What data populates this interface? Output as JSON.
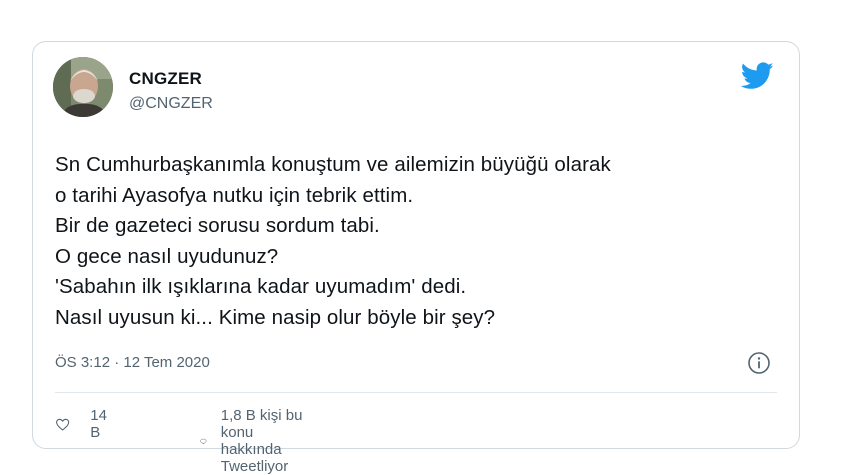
{
  "tweet": {
    "author_name": "CNGZER",
    "author_handle": "@CNGZER",
    "text_lines": [
      "Sn Cumhurbaşkanımla konuştum ve ailemizin büyüğü olarak",
      "o tarihi Ayasofya nutku için tebrik ettim.",
      "Bir de gazeteci sorusu sordum tabi.",
      "O gece nasıl uyudunuz?",
      "'Sabahın ilk ışıklarına kadar uyumadım' dedi.",
      "Nasıl uyusun ki... Kime nasip olur böyle bir şey?"
    ],
    "timestamp": "ÖS 3:12 · 12 Tem 2020",
    "likes": "14 B",
    "replies_text": "1,8 B kişi bu konu hakkında Tweetliyor"
  },
  "colors": {
    "twitter_blue": "#1d9bf0",
    "text": "#0f1419",
    "muted": "#536471",
    "border": "#cfd9de"
  },
  "icons": [
    "twitter-bird-icon",
    "info-icon",
    "heart-icon",
    "reply-bubble-icon"
  ]
}
